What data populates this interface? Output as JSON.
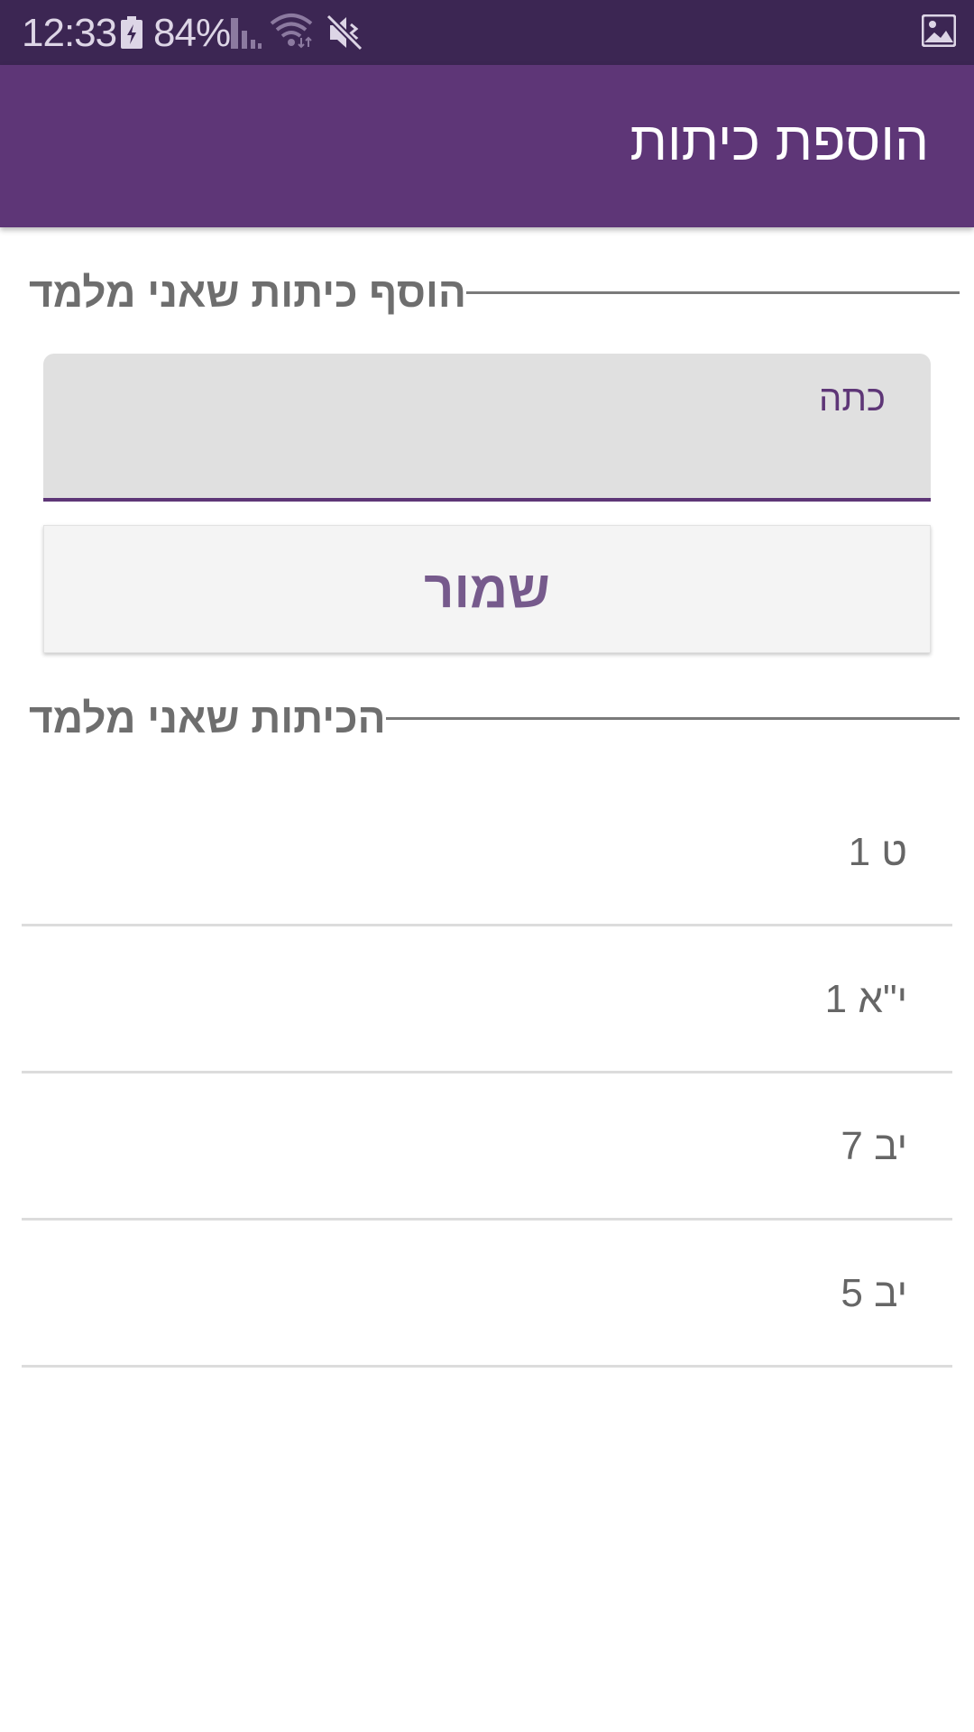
{
  "status_bar": {
    "time": "12:33",
    "battery_percent": "84%",
    "icons": [
      "battery-charging-icon",
      "signal-icon",
      "wifi-icon",
      "mute-icon",
      "image-icon"
    ]
  },
  "app_bar": {
    "title": "הוספת כיתות"
  },
  "add_section": {
    "header": "הוסף כיתות שאני מלמד",
    "field_label": "כתה",
    "field_value": "",
    "save_label": "שמור"
  },
  "list_section": {
    "header": "הכיתות שאני מלמד",
    "items": [
      {
        "label": "ט 1"
      },
      {
        "label": "י\"א 1"
      },
      {
        "label": "יב 7"
      },
      {
        "label": "יב 5"
      }
    ]
  },
  "colors": {
    "status_bar": "#3c2653",
    "app_bar": "#5e3677",
    "accent": "#5e3677",
    "button_text": "#765a8c",
    "header_text": "#6e6e6e"
  }
}
